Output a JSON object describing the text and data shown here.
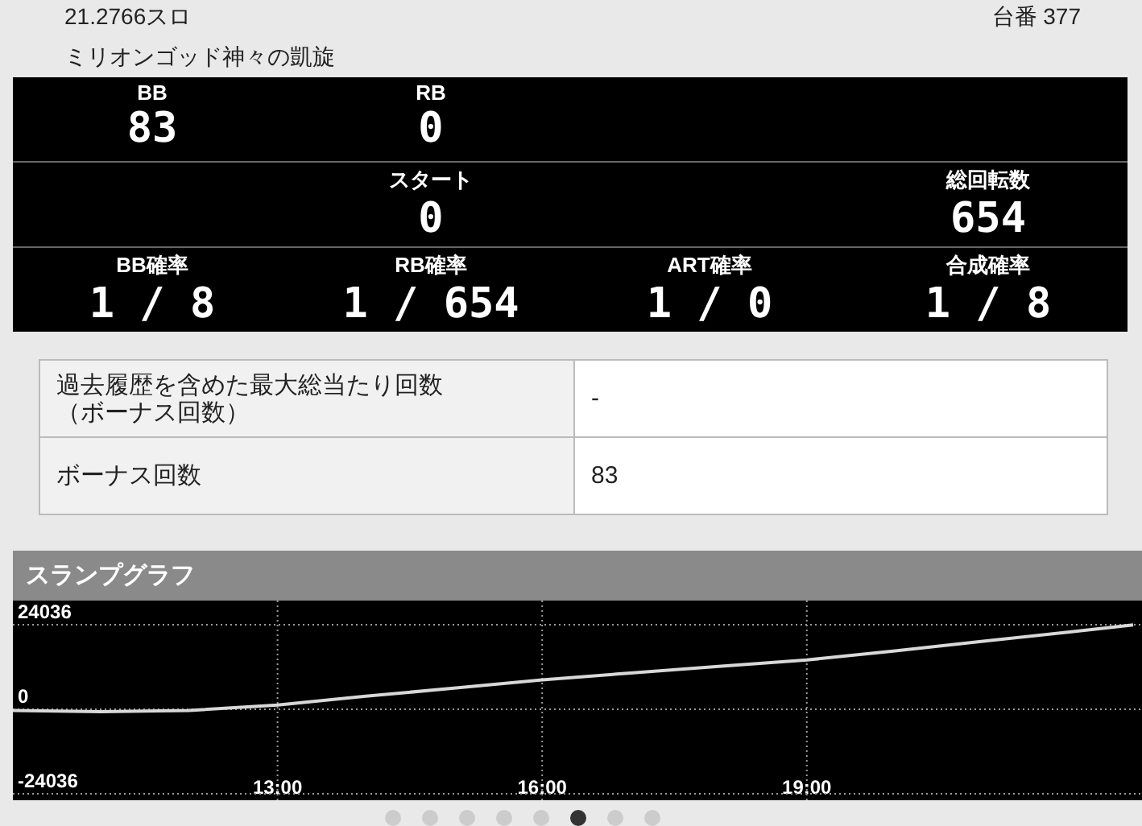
{
  "header": {
    "rate": "21.2766スロ",
    "machine_no": "台番 377",
    "machine_name": "ミリオンゴッド神々の凱旋"
  },
  "stats_rows": [
    [
      {
        "label": "BB",
        "value": "83"
      },
      {
        "label": "RB",
        "value": "0"
      },
      null,
      null
    ],
    [
      null,
      {
        "label": "スタート",
        "value": "0"
      },
      null,
      {
        "label": "総回転数",
        "value": "654"
      }
    ],
    [
      {
        "label": "BB確率",
        "value": "1 / 8"
      },
      {
        "label": "RB確率",
        "value": "1 / 654"
      },
      {
        "label": "ART確率",
        "value": "1 / 0"
      },
      {
        "label": "合成確率",
        "value": "1 / 8"
      }
    ]
  ],
  "info_table": [
    {
      "label": "過去履歴を含めた最大総当たり回数（ボーナス回数）",
      "value": "-"
    },
    {
      "label": "ボーナス回数",
      "value": "83"
    }
  ],
  "slump_graph": {
    "title": "スランプグラフ",
    "chart_data": {
      "type": "line",
      "x": [
        10,
        11,
        12,
        13,
        14,
        15,
        16,
        17,
        18,
        19,
        20,
        21,
        22,
        22.7
      ],
      "series": [
        {
          "color": "#d8d8d8",
          "values": [
            -300,
            -700,
            -300,
            1200,
            3700,
            6000,
            8400,
            10300,
            12200,
            14000,
            16600,
            19300,
            22000,
            24000
          ]
        }
      ],
      "grid": true,
      "xlim": [
        10,
        22.8
      ],
      "ylim": [
        -24036,
        24036
      ],
      "xticks": [
        {
          "value": 13,
          "label": "13:00"
        },
        {
          "value": 16,
          "label": "16:00"
        },
        {
          "value": 19,
          "label": "19:00"
        }
      ],
      "yticks": [
        24036,
        0,
        -24036
      ]
    }
  },
  "pager": [
    {
      "selected": false
    },
    {
      "selected": false
    },
    {
      "selected": false
    },
    {
      "selected": false
    },
    {
      "selected": false
    },
    {
      "selected": true
    },
    {
      "selected": false
    },
    {
      "selected": false
    }
  ]
}
